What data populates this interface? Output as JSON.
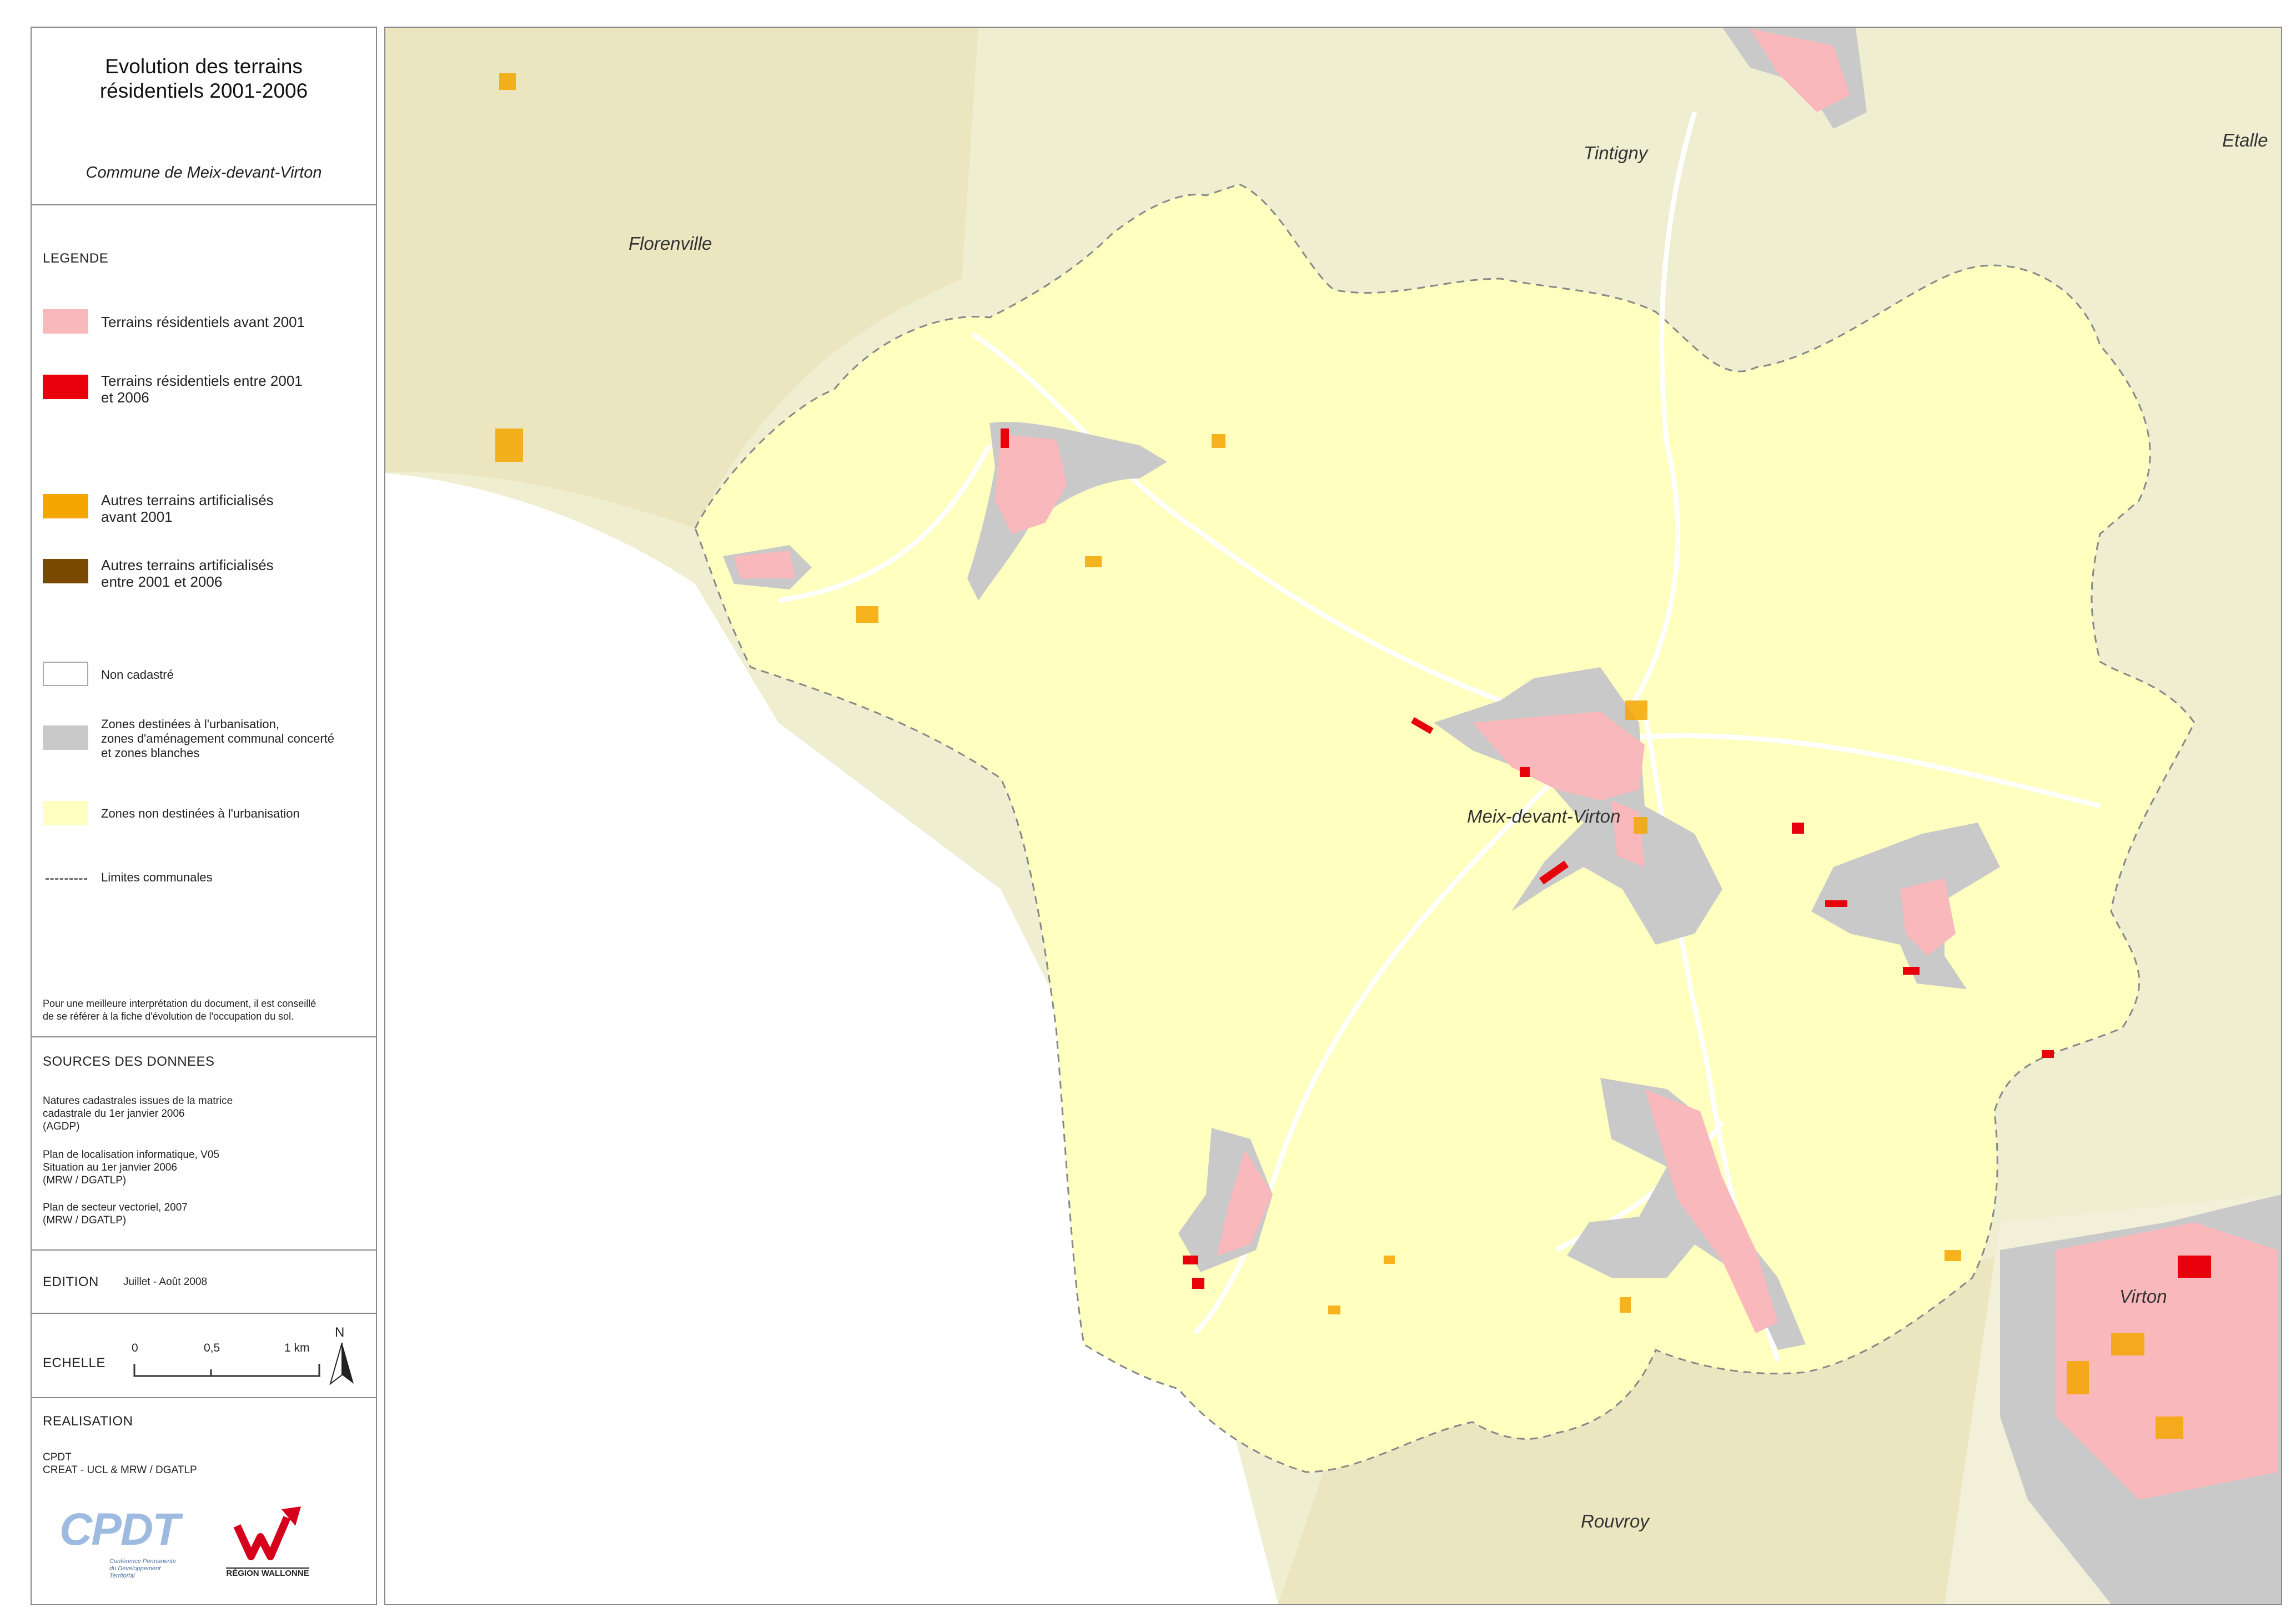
{
  "title": {
    "line1": "Evolution des terrains",
    "line2": "résidentiels 2001-2006",
    "commune": "Commune de Meix-devant-Virton"
  },
  "legend": {
    "heading": "LEGENDE",
    "items": [
      {
        "label": "Terrains résidentiels avant 2001",
        "color": "#f9b8bb"
      },
      {
        "label1": "Terrains résidentiels entre 2001",
        "label2": "et 2006",
        "color": "#e8000b"
      },
      {
        "label1": "Autres terrains artificialisés",
        "label2": "avant 2001",
        "color": "#f5a600"
      },
      {
        "label1": "Autres terrains artificialisés",
        "label2": "entre 2001 et 2006",
        "color": "#7a4a00"
      },
      {
        "label": "Non cadastré",
        "color": "#ffffff"
      },
      {
        "label1": "Zones destinées à l'urbanisation,",
        "label2": "zones d'aménagement communal concerté",
        "label3": "et zones blanches",
        "color": "#c9c9c9"
      },
      {
        "label": "Zones non destinées à l'urbanisation",
        "color": "#ffffc0"
      },
      {
        "label": "Limites communales"
      }
    ],
    "note1": "Pour une meilleure interprétation du document, il est conseillé",
    "note2": "de se référer à la fiche d'évolution de l'occupation du sol."
  },
  "sources": {
    "heading": "SOURCES DES DONNEES",
    "s1": "Natures cadastrales issues de la matrice\ncadastrale du 1er janvier 2006\n(AGDP)",
    "s2": "Plan de localisation informatique, V05\nSituation au 1er janvier 2006\n(MRW / DGATLP)",
    "s3": "Plan de secteur vectoriel, 2007\n(MRW / DGATLP)"
  },
  "edition": {
    "heading": "EDITION",
    "value": "Juillet - Août 2008"
  },
  "scale": {
    "heading": "ECHELLE",
    "t0": "0",
    "t1": "0,5",
    "t2": "1 km",
    "north": "N"
  },
  "realisation": {
    "heading": "REALISATION",
    "line1": "CPDT",
    "line2": "CREAT - UCL & MRW / DGATLP",
    "cpdt_logo": "CPDT",
    "cpdt_sub1": "Conférence Permanente",
    "cpdt_sub2": "du Développement",
    "cpdt_sub3": "Territorial",
    "rw_logo": "RÉGION WALLONNE"
  },
  "map": {
    "places": [
      "Tintigny",
      "Etalle",
      "Florenville",
      "Meix-devant-Virton",
      "Virton",
      "Rouvroy"
    ],
    "colors": {
      "outside": "#efeed0",
      "commune": "#ffffc0",
      "residential_old": "#f9b8bb",
      "residential_new": "#e8000b",
      "artificial_old": "#f5a600",
      "urban_zone": "#c9c9c9"
    }
  }
}
